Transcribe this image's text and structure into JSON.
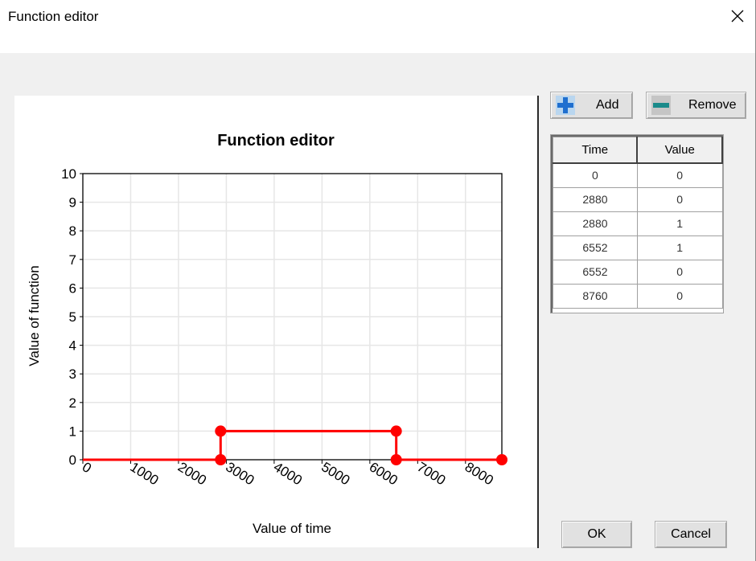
{
  "window": {
    "title": "Function editor",
    "close_glyph": "✕"
  },
  "toolbar": {
    "add_label": "Add",
    "remove_label": "Remove",
    "add_icon": "plus-icon",
    "remove_icon": "minus-icon"
  },
  "table": {
    "headers": [
      "Time",
      "Value"
    ],
    "rows": [
      [
        "0",
        "0"
      ],
      [
        "2880",
        "0"
      ],
      [
        "2880",
        "1"
      ],
      [
        "6552",
        "1"
      ],
      [
        "6552",
        "0"
      ],
      [
        "8760",
        "0"
      ]
    ]
  },
  "footer": {
    "ok_label": "OK",
    "cancel_label": "Cancel"
  },
  "colors": {
    "series": "#ff0000",
    "grid": "#e6e6e6"
  },
  "chart_data": {
    "type": "line",
    "title": "Function editor",
    "xlabel": "Value of time",
    "ylabel": "Value of function",
    "x": [
      0,
      2880,
      2880,
      6552,
      6552,
      8760
    ],
    "y": [
      0,
      0,
      1,
      1,
      0,
      0
    ],
    "xlim": [
      0,
      8760
    ],
    "ylim": [
      0,
      10
    ],
    "xticks": [
      "0",
      "1000",
      "2000",
      "3000",
      "4000",
      "5000",
      "6000",
      "7000",
      "8000"
    ],
    "yticks": [
      "0",
      "1",
      "2",
      "3",
      "4",
      "5",
      "6",
      "7",
      "8",
      "9",
      "10"
    ],
    "grid": true
  }
}
